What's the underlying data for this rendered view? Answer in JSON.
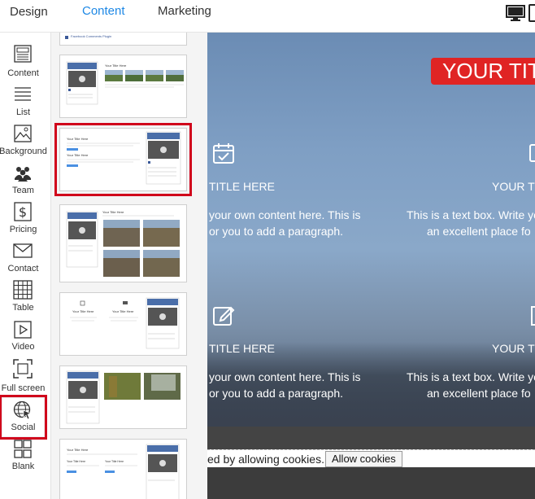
{
  "tabs": {
    "design": "Design",
    "content": "Content",
    "marketing": "Marketing"
  },
  "sidebar": {
    "items": [
      {
        "label": "Content",
        "icon": "page-layout-icon"
      },
      {
        "label": "List",
        "icon": "list-icon"
      },
      {
        "label": "Background",
        "icon": "image-icon"
      },
      {
        "label": "Team",
        "icon": "team-icon"
      },
      {
        "label": "Pricing",
        "icon": "dollar-icon"
      },
      {
        "label": "Contact",
        "icon": "envelope-icon"
      },
      {
        "label": "Table",
        "icon": "table-icon"
      },
      {
        "label": "Video",
        "icon": "play-icon"
      },
      {
        "label": "Full screen",
        "icon": "fullscreen-icon"
      },
      {
        "label": "Social",
        "icon": "globe-cursor-icon"
      },
      {
        "label": "Blank",
        "icon": "blank-grid-icon"
      }
    ],
    "selected": "Social"
  },
  "thumbnails": {
    "caption_top": "Facebook Comments Plugin",
    "title_text": "Your Title Here",
    "selected_index": 1
  },
  "preview": {
    "hero_title": "YOUR TIT",
    "columns": [
      {
        "title": "TITLE HERE",
        "line1": "your own content here. This is",
        "line2": "or you to add a paragraph.",
        "icon": "calendar-check-icon"
      },
      {
        "title": "YOUR T",
        "line1": "This is a text box. Write yo",
        "line2": "an excellent place fo",
        "icon": "image-icon"
      },
      {
        "title": "TITLE HERE",
        "line1": "your own content here. This is",
        "line2": "or you to add a paragraph.",
        "icon": "edit-icon"
      },
      {
        "title": "YOUR T",
        "line1": "This is a text box. Write yo",
        "line2": "an excellent place fo",
        "icon": "bar-icon"
      }
    ],
    "cookie_text": "ed by allowing cookies.",
    "cookie_button": "Allow cookies"
  },
  "colors": {
    "accent": "#1e88e5",
    "highlight": "#d0021b",
    "hero_title_bg": "#e02424"
  }
}
